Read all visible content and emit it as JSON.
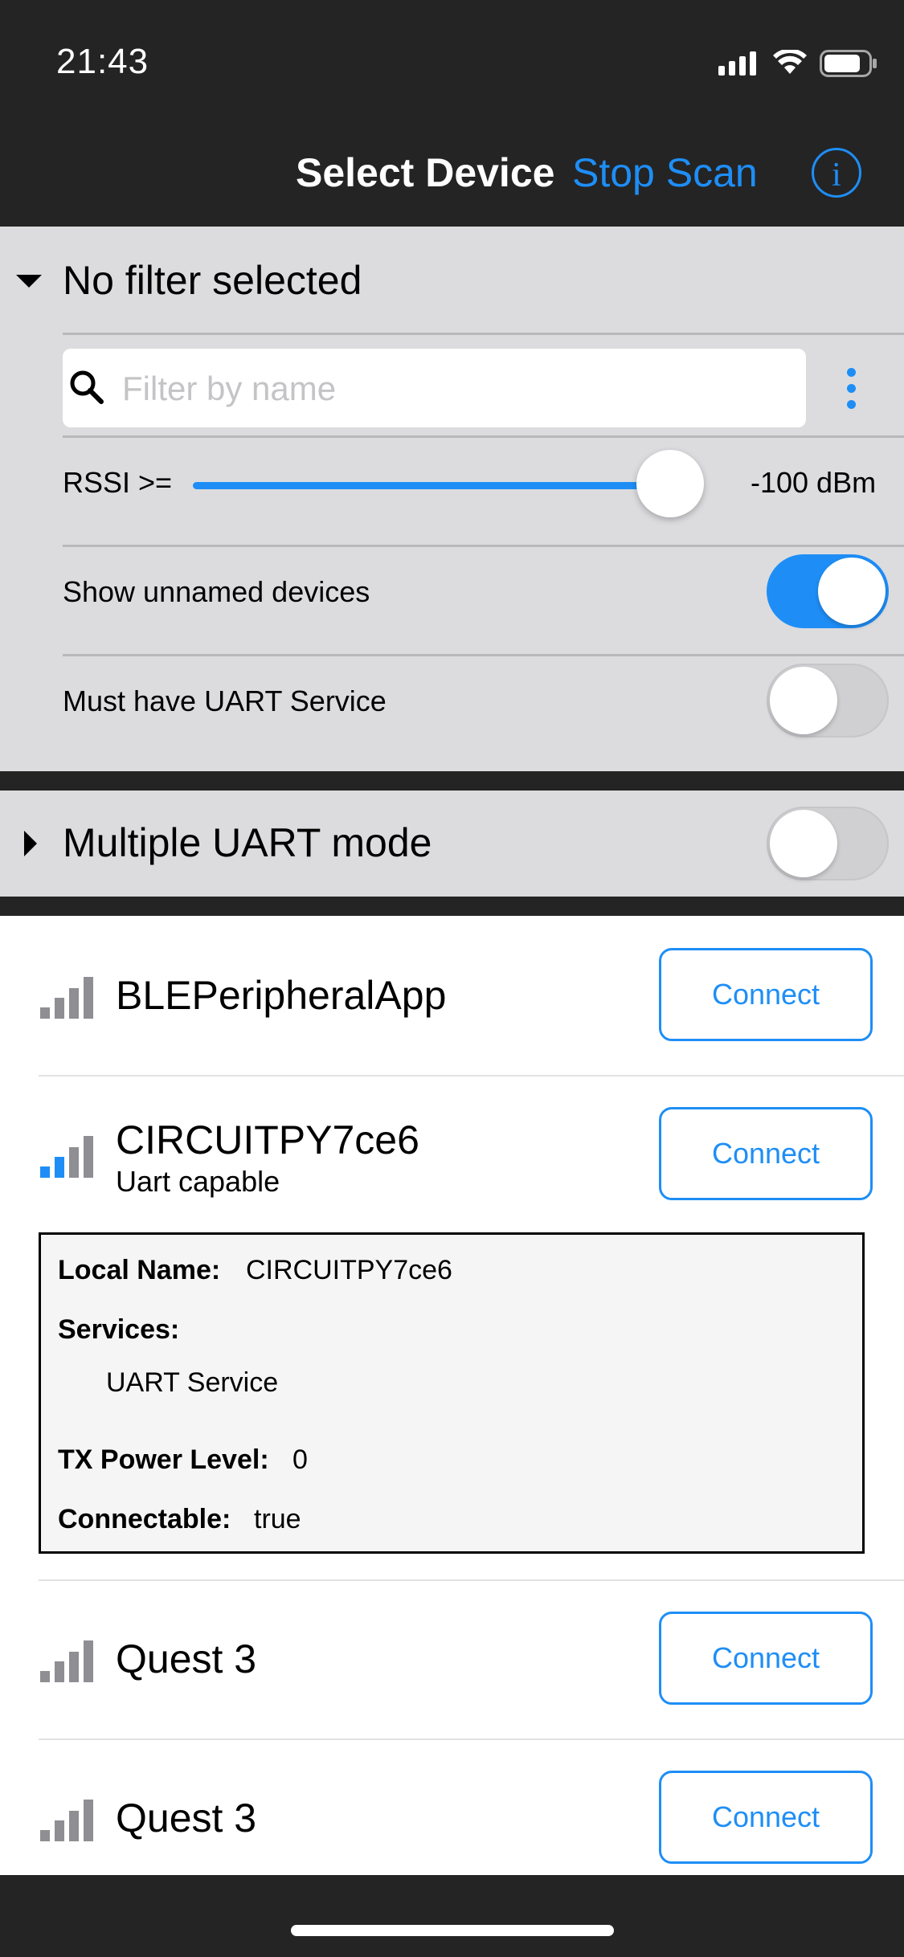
{
  "status_bar": {
    "time": "21:43"
  },
  "nav": {
    "title": "Select Device",
    "stop_scan": "Stop Scan",
    "info_label": "i"
  },
  "filter": {
    "title": "No filter selected",
    "search_placeholder": "Filter by name",
    "search_value": "",
    "rssi_label": "RSSI >=",
    "rssi_value": "-100 dBm",
    "rssi_slider_fraction": 0.92,
    "show_unnamed_label": "Show unnamed devices",
    "show_unnamed_on": true,
    "must_uart_label": "Must have UART Service",
    "must_uart_on": false
  },
  "multi_uart": {
    "title": "Multiple UART mode",
    "on": false
  },
  "devices": [
    {
      "name": "BLEPeripheralApp",
      "subtitle": "",
      "signal": "weak",
      "connect_label": "Connect"
    },
    {
      "name": "CIRCUITPY7ce6",
      "subtitle": "Uart capable",
      "signal": "strong",
      "connect_label": "Connect"
    },
    {
      "name": "Quest 3",
      "subtitle": "",
      "signal": "weak",
      "connect_label": "Connect"
    },
    {
      "name": "Quest 3",
      "subtitle": "",
      "signal": "weak",
      "connect_label": "Connect"
    }
  ],
  "details": {
    "local_name_label": "Local Name:",
    "local_name_value": "CIRCUITPY7ce6",
    "services_label": "Services:",
    "service_item": "UART Service",
    "tx_label": "TX Power Level:",
    "tx_value": "0",
    "connectable_label": "Connectable:",
    "connectable_value": "true"
  },
  "colors": {
    "accent": "#1e8ef6",
    "bar_dark": "#242424",
    "panel": "#dcdcdf",
    "signal_inactive": "#8e8e93"
  }
}
